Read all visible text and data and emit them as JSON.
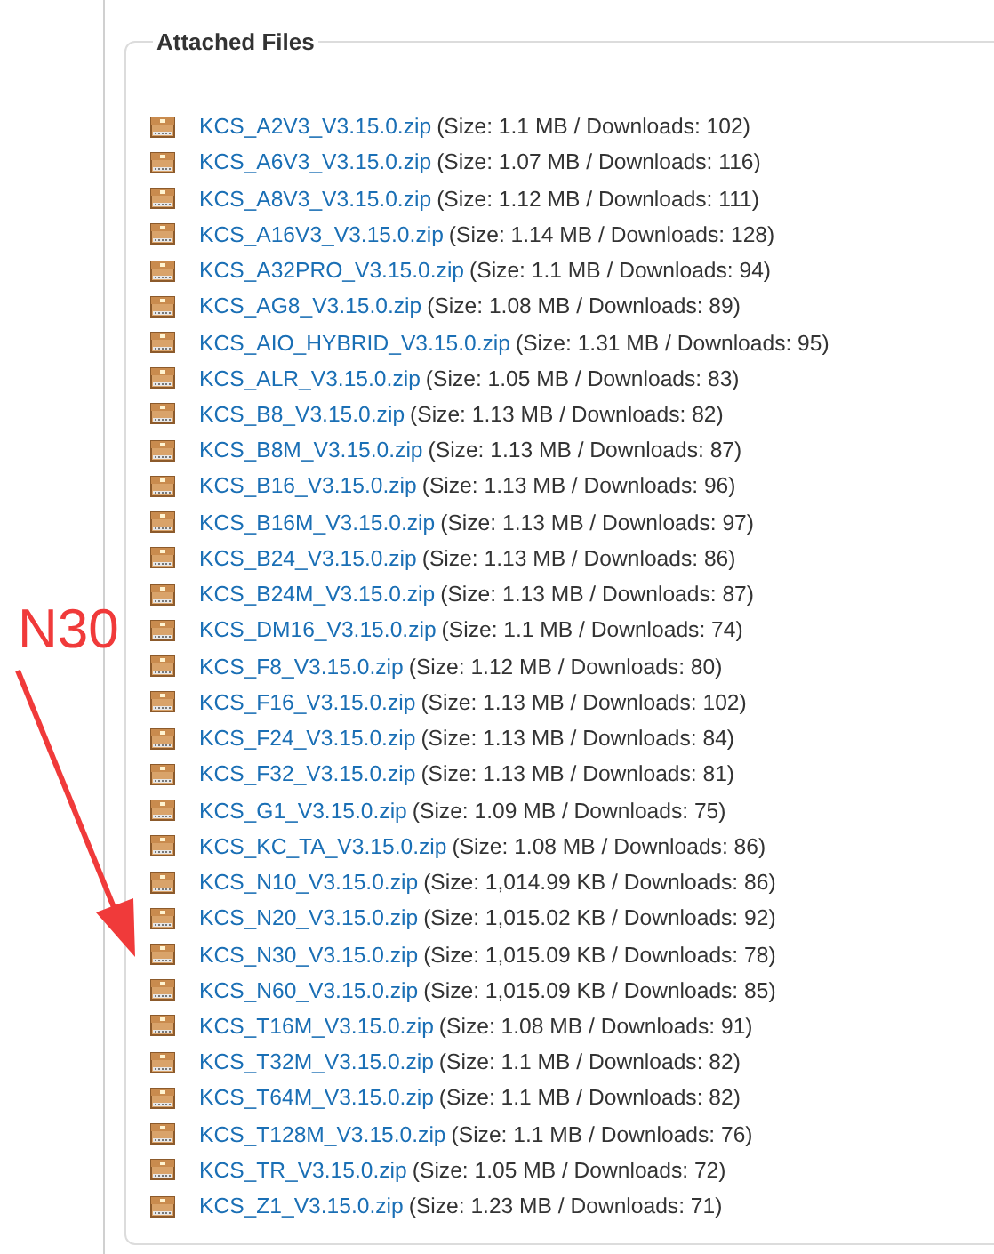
{
  "attached_files": {
    "title": "Attached Files",
    "files": [
      {
        "name": "KCS_A2V3_V3.15.0.zip",
        "info": "(Size: 1.1 MB / Downloads: 102)"
      },
      {
        "name": "KCS_A6V3_V3.15.0.zip",
        "info": "(Size: 1.07 MB / Downloads: 116)"
      },
      {
        "name": "KCS_A8V3_V3.15.0.zip",
        "info": "(Size: 1.12 MB / Downloads: 111)"
      },
      {
        "name": "KCS_A16V3_V3.15.0.zip",
        "info": "(Size: 1.14 MB / Downloads: 128)"
      },
      {
        "name": "KCS_A32PRO_V3.15.0.zip",
        "info": "(Size: 1.1 MB / Downloads: 94)"
      },
      {
        "name": "KCS_AG8_V3.15.0.zip",
        "info": "(Size: 1.08 MB / Downloads: 89)"
      },
      {
        "name": "KCS_AIO_HYBRID_V3.15.0.zip",
        "info": "(Size: 1.31 MB / Downloads: 95)"
      },
      {
        "name": "KCS_ALR_V3.15.0.zip",
        "info": "(Size: 1.05 MB / Downloads: 83)"
      },
      {
        "name": "KCS_B8_V3.15.0.zip",
        "info": "(Size: 1.13 MB / Downloads: 82)"
      },
      {
        "name": "KCS_B8M_V3.15.0.zip",
        "info": "(Size: 1.13 MB / Downloads: 87)"
      },
      {
        "name": "KCS_B16_V3.15.0.zip",
        "info": "(Size: 1.13 MB / Downloads: 96)"
      },
      {
        "name": "KCS_B16M_V3.15.0.zip",
        "info": "(Size: 1.13 MB / Downloads: 97)"
      },
      {
        "name": "KCS_B24_V3.15.0.zip",
        "info": "(Size: 1.13 MB / Downloads: 86)"
      },
      {
        "name": "KCS_B24M_V3.15.0.zip",
        "info": "(Size: 1.13 MB / Downloads: 87)"
      },
      {
        "name": "KCS_DM16_V3.15.0.zip",
        "info": "(Size: 1.1 MB / Downloads: 74)"
      },
      {
        "name": "KCS_F8_V3.15.0.zip",
        "info": "(Size: 1.12 MB / Downloads: 80)"
      },
      {
        "name": "KCS_F16_V3.15.0.zip",
        "info": "(Size: 1.13 MB / Downloads: 102)"
      },
      {
        "name": "KCS_F24_V3.15.0.zip",
        "info": "(Size: 1.13 MB / Downloads: 84)"
      },
      {
        "name": "KCS_F32_V3.15.0.zip",
        "info": "(Size: 1.13 MB / Downloads: 81)"
      },
      {
        "name": "KCS_G1_V3.15.0.zip",
        "info": "(Size: 1.09 MB / Downloads: 75)"
      },
      {
        "name": "KCS_KC_TA_V3.15.0.zip",
        "info": "(Size: 1.08 MB / Downloads: 86)"
      },
      {
        "name": "KCS_N10_V3.15.0.zip",
        "info": "(Size: 1,014.99 KB / Downloads: 86)"
      },
      {
        "name": "KCS_N20_V3.15.0.zip",
        "info": "(Size: 1,015.02 KB / Downloads: 92)"
      },
      {
        "name": "KCS_N30_V3.15.0.zip",
        "info": "(Size: 1,015.09 KB / Downloads: 78)"
      },
      {
        "name": "KCS_N60_V3.15.0.zip",
        "info": "(Size: 1,015.09 KB / Downloads: 85)"
      },
      {
        "name": "KCS_T16M_V3.15.0.zip",
        "info": "(Size: 1.08 MB / Downloads: 91)"
      },
      {
        "name": "KCS_T32M_V3.15.0.zip",
        "info": "(Size: 1.1 MB / Downloads: 82)"
      },
      {
        "name": "KCS_T64M_V3.15.0.zip",
        "info": "(Size: 1.1 MB / Downloads: 82)"
      },
      {
        "name": "KCS_T128M_V3.15.0.zip",
        "info": "(Size: 1.1 MB / Downloads: 76)"
      },
      {
        "name": "KCS_TR_V3.15.0.zip",
        "info": "(Size: 1.05 MB / Downloads: 72)"
      },
      {
        "name": "KCS_Z1_V3.15.0.zip",
        "info": "(Size: 1.23 MB / Downloads: 71)"
      }
    ]
  },
  "annotation": {
    "label": "N30"
  }
}
